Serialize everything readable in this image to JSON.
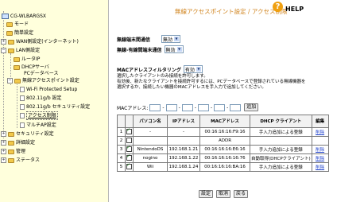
{
  "sidebar": {
    "device": "CG-WLBARGSX",
    "items": [
      {
        "label": "モード"
      },
      {
        "label": "簡単設定"
      },
      {
        "label": "WAN側設定(インターネット)"
      },
      {
        "label": "LAN側設定"
      },
      {
        "label": "ルータIP"
      },
      {
        "label": "DHCPサーバ"
      },
      {
        "label": "PCデータベース"
      },
      {
        "label": "無線アクセスポイント設定"
      },
      {
        "label": "Wi-Fi Protected Setup"
      },
      {
        "label": "802.11g/b 設定"
      },
      {
        "label": "802.11g/b セキュリティ設定"
      },
      {
        "label": "アクセス制限"
      },
      {
        "label": "マルチAP設定"
      },
      {
        "label": "セキュリティ設定"
      },
      {
        "label": "詳細設定"
      },
      {
        "label": "管理"
      },
      {
        "label": "ステータス"
      }
    ]
  },
  "header": {
    "title": "無線アクセスポイント設定 / アクセス制限",
    "help_label": "HELP",
    "help_icon": "question-mark-icon"
  },
  "settings": {
    "wireless_comm_label": "無線端末間通信",
    "wireless_comm_value": "無効",
    "wired_wireless_label": "無線-有線間端末通信",
    "wired_wireless_value": "無効",
    "mac_filter_label": "MACアドレスフィルタリング",
    "mac_filter_value": "有効"
  },
  "description": [
    "選択したクライアントのみ接続を許可します。",
    "有効後、新たなクライアントを接続許可するには、PCデータベースで登録されている無線機器を",
    "選択するか、接続したい機器のMACアドレスを手入力で追加してください。"
  ],
  "mac_input": {
    "label": "MACアドレス:",
    "add_button": "追加"
  },
  "table": {
    "headers": [
      "",
      "",
      "パソコン名",
      "IPアドレス",
      "MACアドレス",
      "DHCP クライアント",
      "編集"
    ],
    "rows": [
      {
        "no": "1",
        "checked": true,
        "name": "-",
        "ip": "-",
        "mac": "00:16:16:16:F9:16",
        "dhcp": "手入力追加による登録",
        "edit": "削除"
      },
      {
        "no": "2",
        "checked": false,
        "name": "",
        "ip": "",
        "mac": "ADDR",
        "dhcp": "",
        "edit": ""
      },
      {
        "no": "3",
        "checked": true,
        "name": "NintendoDS",
        "ip": "192.168.1.21",
        "mac": "00:16:16:16:E6:16",
        "dhcp": "手入力追加による登録",
        "edit": "削除"
      },
      {
        "no": "4",
        "checked": true,
        "name": "nogino",
        "ip": "192.168.1.22",
        "mac": "00:16:16:16:16:76",
        "dhcp": "自動取得(DHCPクライアント)",
        "edit": "削除"
      },
      {
        "no": "5",
        "checked": true,
        "name": "Wii",
        "ip": "192.168.1.24",
        "mac": "00:16:16:16:BA:16",
        "dhcp": "手入力追加による登録",
        "edit": "削除"
      }
    ]
  },
  "buttons": {
    "save": "設定",
    "cancel": "取消",
    "back": "戻る"
  },
  "colors": {
    "sidebar_bg": "#ffffdc",
    "title": "#d0831c",
    "help": "#f0a010",
    "link": "#2244cc"
  }
}
